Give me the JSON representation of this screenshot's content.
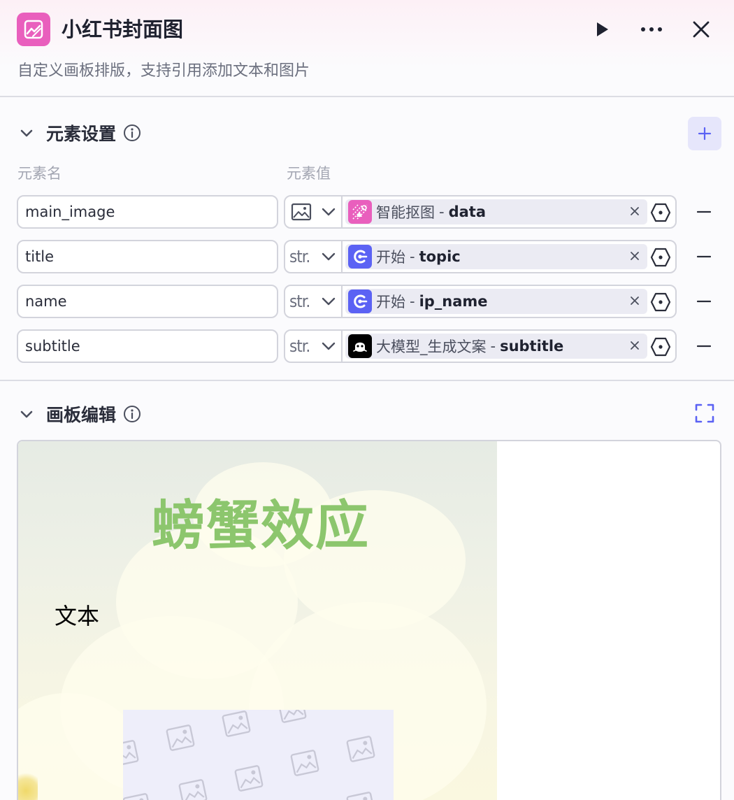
{
  "header": {
    "title": "小红书封面图",
    "description": "自定义画板排版，支持引用添加文本和图片",
    "icon": "image-edit-icon",
    "accent": "#e95fbd"
  },
  "elements_section": {
    "title": "元素设置",
    "col_name": "元素名",
    "col_value": "元素值",
    "rows": [
      {
        "name": "main_image",
        "type": "image",
        "type_label": "",
        "source": "智能抠图",
        "field": "data",
        "source_color": "#e95fbd"
      },
      {
        "name": "title",
        "type": "str",
        "type_label": "str.",
        "source": "开始",
        "field": "topic",
        "source_color": "#5b62f4"
      },
      {
        "name": "name",
        "type": "str",
        "type_label": "str.",
        "source": "开始",
        "field": "ip_name",
        "source_color": "#5b62f4"
      },
      {
        "name": "subtitle",
        "type": "str",
        "type_label": "str.",
        "source": "大模型_生成文案",
        "field": "subtitle",
        "source_color": "#000000"
      }
    ],
    "separator": "-"
  },
  "canvas_section": {
    "title": "画板编辑",
    "canvas_title": "螃蟹效应",
    "canvas_text": "文本"
  }
}
